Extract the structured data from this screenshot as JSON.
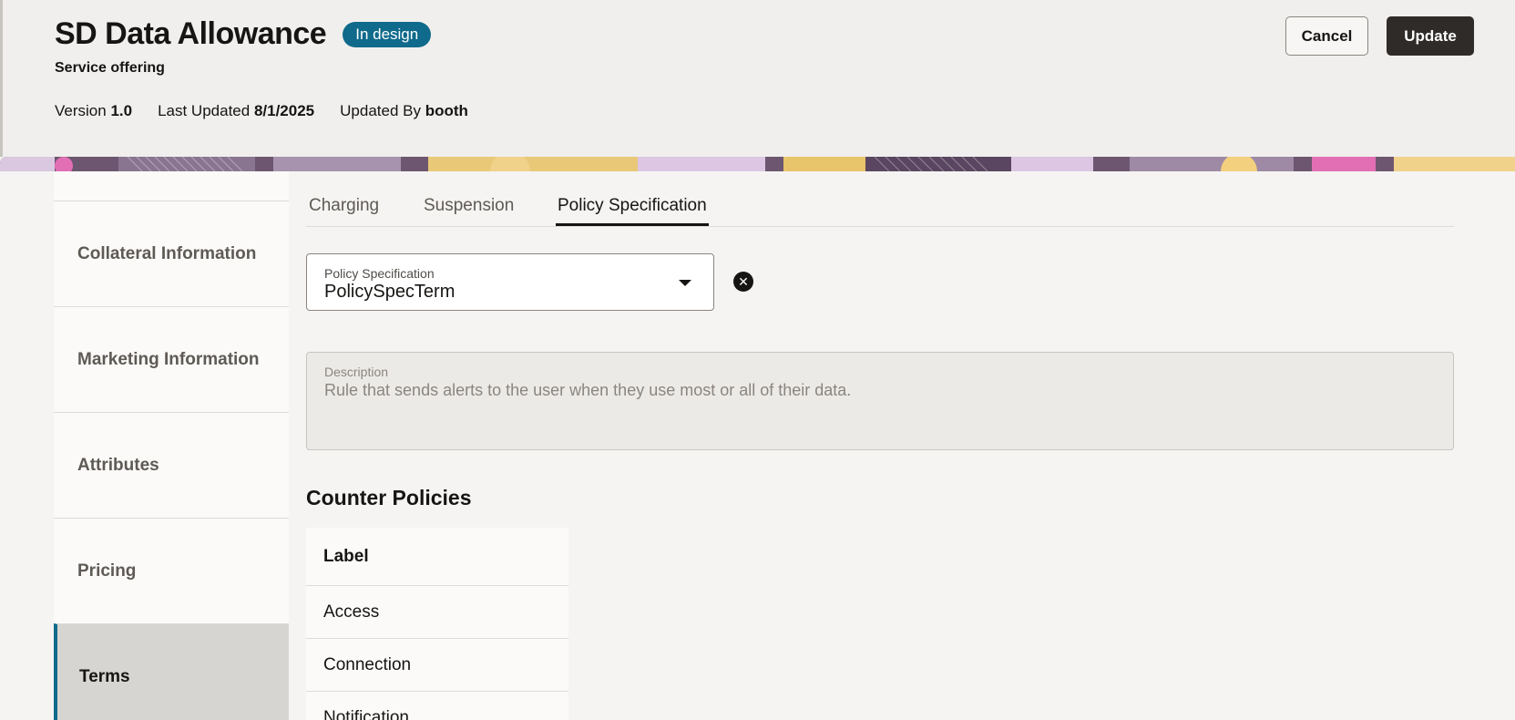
{
  "header": {
    "title": "SD Data Allowance",
    "status_badge": "In design",
    "subtitle": "Service offering",
    "meta": {
      "version_label": "Version",
      "version_value": "1.0",
      "last_updated_label": "Last Updated",
      "last_updated_value": "8/1/2025",
      "updated_by_label": "Updated By",
      "updated_by_value": "booth"
    },
    "cancel_label": "Cancel",
    "update_label": "Update"
  },
  "sidebar": {
    "items": [
      {
        "label": "Collateral Information"
      },
      {
        "label": "Marketing Information"
      },
      {
        "label": "Attributes"
      },
      {
        "label": "Pricing"
      },
      {
        "label": "Terms"
      }
    ]
  },
  "tabs": [
    {
      "label": "Charging"
    },
    {
      "label": "Suspension"
    },
    {
      "label": "Policy Specification"
    }
  ],
  "policy_select": {
    "label": "Policy Specification",
    "value": "PolicySpecTerm"
  },
  "description": {
    "label": "Description",
    "value": "Rule that sends alerts to the user when they use most or all of their data."
  },
  "counter_policies": {
    "title": "Counter Policies",
    "column_header": "Label",
    "rows": [
      "Access",
      "Connection",
      "Notification"
    ]
  },
  "colors": {
    "badge": "#0f6a8b",
    "primary_button": "#2e2b28",
    "selected_nav_bar": "#0f6a8b"
  }
}
